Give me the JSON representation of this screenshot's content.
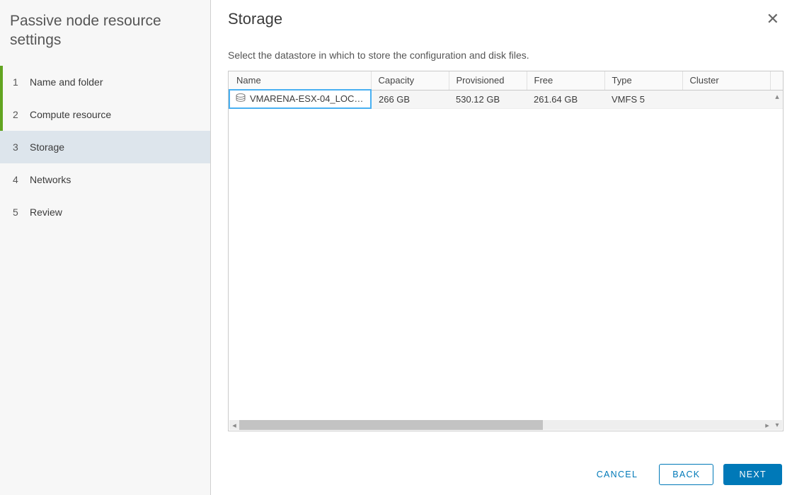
{
  "sidebar": {
    "title": "Passive node resource settings",
    "steps": [
      {
        "num": "1",
        "label": "Name and folder"
      },
      {
        "num": "2",
        "label": "Compute resource"
      },
      {
        "num": "3",
        "label": "Storage"
      },
      {
        "num": "4",
        "label": "Networks"
      },
      {
        "num": "5",
        "label": "Review"
      }
    ]
  },
  "page": {
    "title": "Storage",
    "subtitle": "Select the datastore in which to store the configuration and disk files."
  },
  "table": {
    "headers": {
      "name": "Name",
      "capacity": "Capacity",
      "provisioned": "Provisioned",
      "free": "Free",
      "type": "Type",
      "cluster": "Cluster"
    },
    "rows": [
      {
        "name": "VMARENA-ESX-04_LOC…",
        "capacity": "266 GB",
        "provisioned": "530.12 GB",
        "free": "261.64 GB",
        "type": "VMFS 5",
        "cluster": ""
      }
    ]
  },
  "buttons": {
    "cancel": "CANCEL",
    "back": "BACK",
    "next": "NEXT"
  }
}
